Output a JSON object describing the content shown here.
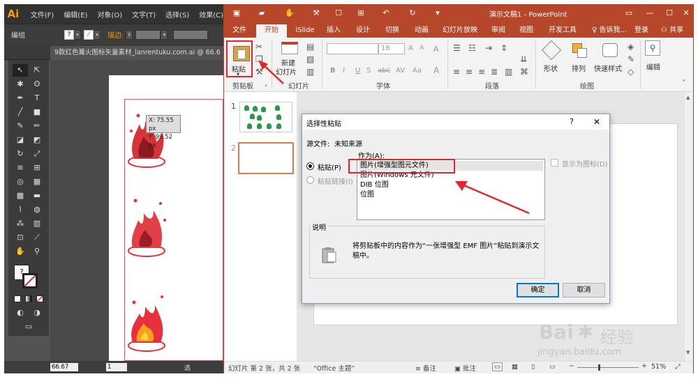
{
  "illustrator": {
    "logo": "Ai",
    "menu": [
      "文件(F)",
      "编辑(E)",
      "对象(O)",
      "文字(T)",
      "选择(S)",
      "效果(C)"
    ],
    "control_label": "编组",
    "stroke_label": "描边:",
    "doc_tab": "9款红色篝火图标矢量素材_lanrentuku.com.ai @ 66.6",
    "tooltip_x": "X: 75.55 px",
    "tooltip_y": "Y: 99.52 px",
    "zoom": "66.67",
    "page": "1",
    "status": "选"
  },
  "ppt": {
    "title": "演示文稿1 - PowerPoint",
    "tabs": [
      "文件",
      "开始",
      "iSlide",
      "插入",
      "设计",
      "切换",
      "动画",
      "幻灯片放映",
      "审阅",
      "视图",
      "开发工具"
    ],
    "active_tab": "开始",
    "tell_me": "告诉我...",
    "login": "登录",
    "share": "共享",
    "paste_label": "粘贴",
    "new_slide_label": "新建",
    "new_slide_label2": "幻灯片",
    "font_size": "18",
    "shape_label": "形状",
    "arrange_label": "排列",
    "quick_style_label": "快速样式",
    "edit_label": "编辑",
    "groups": [
      "剪贴板",
      "幻灯片",
      "字体",
      "段落",
      "绘图"
    ],
    "slide_numbers": [
      "1",
      "2"
    ],
    "status_left": "幻灯片 第 2 张，共 2 张",
    "status_theme": "“Office 主题”",
    "notes_label": "备注",
    "comments_label": "批注",
    "zoom": "51%"
  },
  "dialog": {
    "title": "选择性粘贴",
    "help": "?",
    "source_label": "源文件:",
    "source_value": "未知来源",
    "as_label": "作为(A):",
    "paste_option": "粘贴(P)",
    "paste_link_option": "粘贴链接(I)",
    "items": [
      "图片(增强型图元文件)",
      "图片(Windows 元文件)",
      "DIB 位图",
      "位图"
    ],
    "selected_index": 0,
    "display_as_icon": "显示为图标(D)",
    "desc_label": "说明",
    "desc_text_1": "将剪贴板中的内容作为“一张增强型 EMF 图片”粘贴到演示文",
    "desc_text_2": "稿中。",
    "ok": "确定",
    "cancel": "取消"
  },
  "watermark": {
    "brand": "Bai",
    "brand_cn": "经验",
    "url": "jingyan.baidu.com"
  },
  "colors": {
    "ppt_accent": "#b7472a",
    "highlight_red": "#e8242a",
    "fire_red": "#e8303a",
    "leaf_green": "#2a9a4a"
  }
}
